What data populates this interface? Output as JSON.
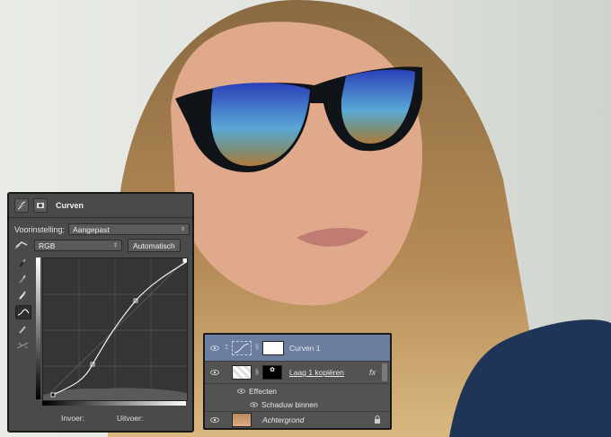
{
  "curves": {
    "title": "Curven",
    "preset_label": "Voorinstelling:",
    "preset_value": "Aangepast",
    "channel_value": "RGB",
    "auto_button": "Automatisch",
    "input_label": "Invoer:",
    "output_label": "Uitvoer:",
    "tools": [
      "eyedropper-black-icon",
      "eyedropper-gray-icon",
      "eyedropper-white-icon",
      "curve-point-icon",
      "pencil-icon",
      "smooth-icon"
    ]
  },
  "layers": {
    "rows": [
      {
        "name": "Curven 1",
        "selected": true
      },
      {
        "name": "Laag 1 kopiëren",
        "fx": "fx"
      },
      {
        "name": "Effecten"
      },
      {
        "name": "Schaduw binnen"
      },
      {
        "name": "Achtergrond",
        "locked": true
      }
    ]
  },
  "colors": {
    "panel": "#4a4a4a",
    "selection": "#6c7ea0",
    "photo_bg": "#cfcac3"
  }
}
